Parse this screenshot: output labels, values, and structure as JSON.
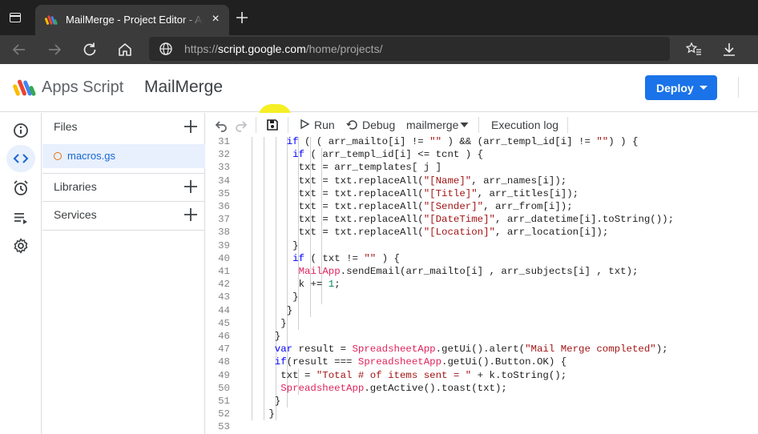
{
  "browser": {
    "tab_title": "MailMerge - Project Editor - Apps Script",
    "tab_close": "×",
    "url_scheme": "https://",
    "url_host": "script.google.com",
    "url_path": "/home/projects/"
  },
  "app": {
    "product_name": "Apps Script",
    "project_name": "MailMerge",
    "deploy_label": "Deploy",
    "brand_color": "#1a73e8"
  },
  "rail": {
    "items": [
      "info-icon",
      "code-icon",
      "triggers-icon",
      "executions-icon",
      "settings-icon"
    ],
    "active": "code-icon"
  },
  "files_panel": {
    "files_label": "Files",
    "file_name": "macros.gs",
    "libraries_label": "Libraries",
    "services_label": "Services"
  },
  "toolbar": {
    "run_label": "Run",
    "debug_label": "Debug",
    "function_select": "mailmerge",
    "execution_log_label": "Execution log",
    "highlight_color": "#f6ee1a"
  },
  "editor": {
    "lines": [
      {
        "n": "31",
        "code": "if ( ( arr_mailto[i] != \"\" ) && (arr_templ_id[i] != \"\") ) {"
      },
      {
        "n": "32",
        "code": "if ( arr_templ_id[i] <= tcnt ) {"
      },
      {
        "n": "33",
        "code": "txt = arr_templates[ j ]"
      },
      {
        "n": "34",
        "code": "txt = txt.replaceAll(\"[Name]\", arr_names[i]);"
      },
      {
        "n": "35",
        "code": "txt = txt.replaceAll(\"[Title]\", arr_titles[i]);"
      },
      {
        "n": "36",
        "code": "txt = txt.replaceAll(\"[Sender]\", arr_from[i]);"
      },
      {
        "n": "37",
        "code": "txt = txt.replaceAll(\"[DateTime]\", arr_datetime[i].toString());"
      },
      {
        "n": "38",
        "code": "txt = txt.replaceAll(\"[Location]\", arr_location[i]);"
      },
      {
        "n": "39",
        "code": "}"
      },
      {
        "n": "40",
        "code": "if ( txt != \"\" ) {"
      },
      {
        "n": "41",
        "code": "MailApp.sendEmail(arr_mailto[i] , arr_subjects[i] , txt);"
      },
      {
        "n": "42",
        "code": "k += 1;"
      },
      {
        "n": "43",
        "code": "}"
      },
      {
        "n": "44",
        "code": "}"
      },
      {
        "n": "45",
        "code": "}"
      },
      {
        "n": "46",
        "code": "}"
      },
      {
        "n": "47",
        "code": "var result = SpreadsheetApp.getUi().alert(\"Mail Merge completed\");"
      },
      {
        "n": "48",
        "code": "if(result === SpreadsheetApp.getUi().Button.OK) {"
      },
      {
        "n": "49",
        "code": "txt = \"Total # of items sent = \" + k.toString();"
      },
      {
        "n": "50",
        "code": "SpreadsheetApp.getActive().toast(txt);"
      },
      {
        "n": "51",
        "code": "}"
      },
      {
        "n": "52",
        "code": "}"
      },
      {
        "n": "53",
        "code": ""
      }
    ]
  }
}
